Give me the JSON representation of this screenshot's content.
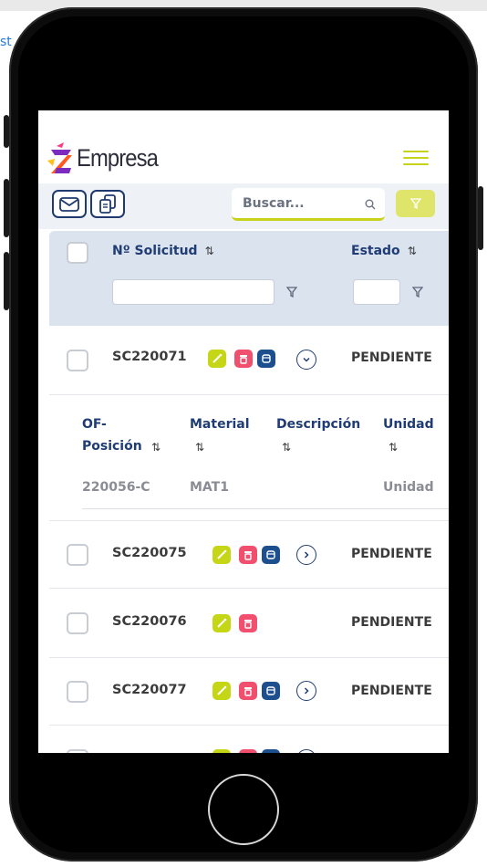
{
  "app": {
    "logo_text": "Empresa"
  },
  "search": {
    "placeholder": "Buscar..."
  },
  "table": {
    "headers": {
      "solicitud": "Nº Solicitud",
      "estado": "Estado",
      "sort_glyph": "⇅"
    },
    "rows": [
      {
        "code": "SC220071",
        "status": "PENDIENTE",
        "expanded": true
      },
      {
        "code": "SC220075",
        "status": "PENDIENTE",
        "expanded": false
      },
      {
        "code": "SC220076",
        "status": "PENDIENTE",
        "expanded": false
      },
      {
        "code": "SC220077",
        "status": "PENDIENTE",
        "expanded": false
      }
    ],
    "detail": {
      "headers": {
        "of_line1": "OF-",
        "of_line2": "Posición",
        "material": "Material",
        "descripcion": "Descripción",
        "unidad": "Unidad"
      },
      "row": {
        "of": "220056-C",
        "material": "MAT1",
        "descripcion": "",
        "unidad": "Unidad"
      }
    }
  },
  "colors": {
    "accent_lime": "#c9d21b",
    "navy": "#1f3c74",
    "badge_green": "#c5d617",
    "badge_pink": "#f0506e",
    "badge_blue": "#1d4f8f",
    "header_bg": "#dbe3ef"
  },
  "icons": [
    "mail-icon",
    "copy-icon",
    "search-icon",
    "filter-icon",
    "magic-wand-icon",
    "trash-icon",
    "box-icon",
    "chevron-down-icon",
    "chevron-right-icon",
    "menu-icon"
  ]
}
